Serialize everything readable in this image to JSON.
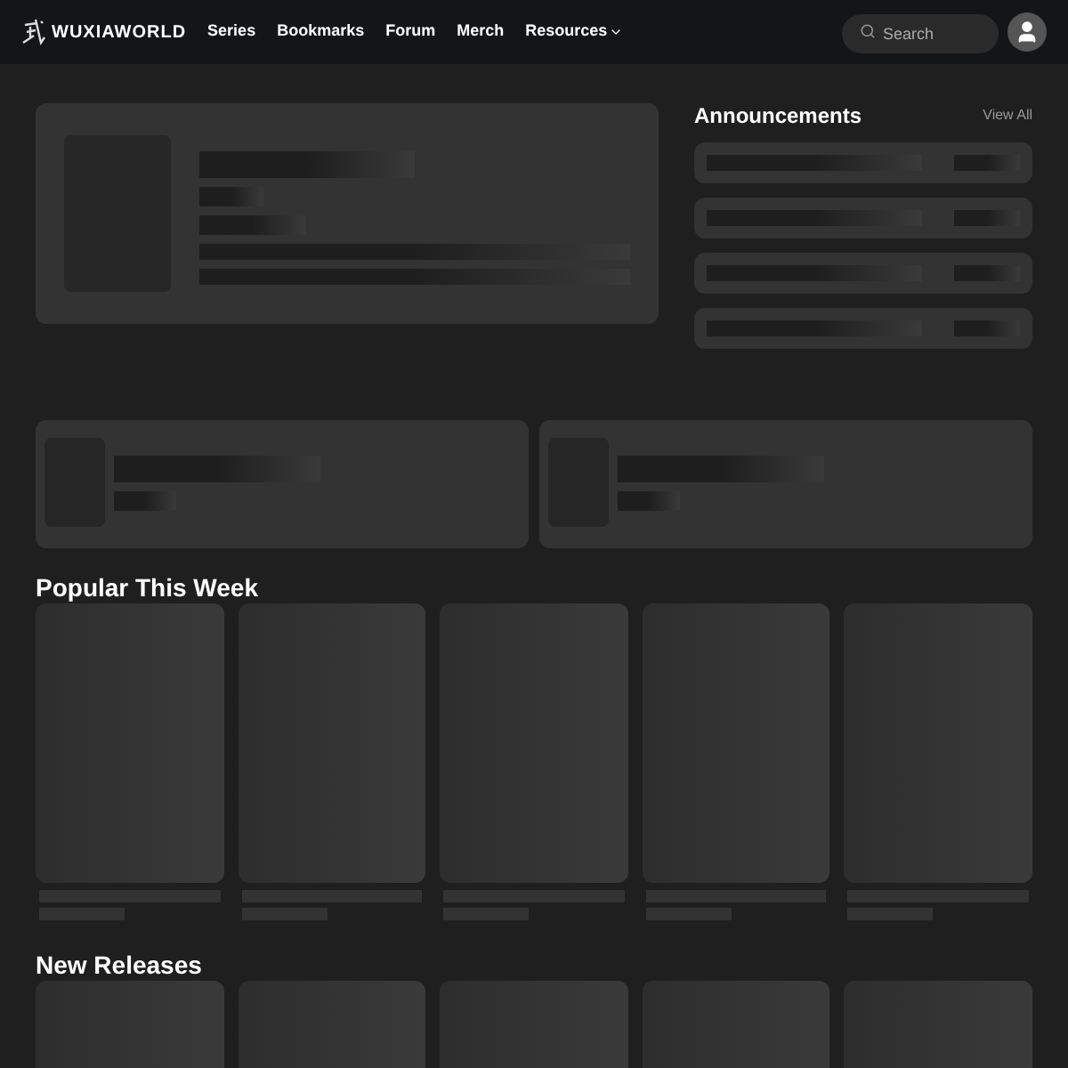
{
  "header": {
    "brand": "WUXIAWORLD",
    "nav": [
      {
        "label": "Series",
        "dropdown": false
      },
      {
        "label": "Bookmarks",
        "dropdown": false
      },
      {
        "label": "Forum",
        "dropdown": false
      },
      {
        "label": "Merch",
        "dropdown": false
      },
      {
        "label": "Resources",
        "dropdown": true
      }
    ],
    "search": {
      "placeholder": "Search"
    }
  },
  "announcements": {
    "title": "Announcements",
    "link": "View All"
  },
  "sections": [
    {
      "title": "Popular This Week"
    },
    {
      "title": "New Releases"
    }
  ]
}
